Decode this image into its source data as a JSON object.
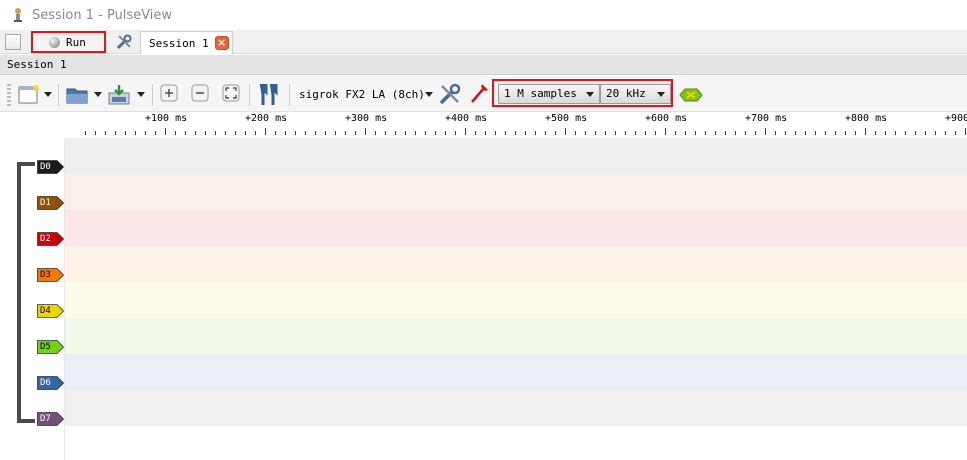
{
  "window": {
    "title": "Session 1 - PulseView"
  },
  "main_toolbar": {
    "run_label": "Run",
    "tabs": [
      {
        "label": "Session 1",
        "close_glyph": "×"
      }
    ]
  },
  "session": {
    "header_label": "Session 1",
    "device_label": "sigrok FX2 LA (8ch)",
    "sample_count": "1 M samples",
    "sample_rate": "20 kHz"
  },
  "ruler": {
    "labels": [
      "+100 ms",
      "+200 ms",
      "+300 ms",
      "+400 ms",
      "+500 ms",
      "+600 ms",
      "+700 ms",
      "+800 ms",
      "+900"
    ]
  },
  "channels": [
    {
      "name": "D0",
      "color": "#1c1c1c",
      "text_color": "#ffffff",
      "lane_bg": "#eeeeee"
    },
    {
      "name": "D1",
      "color": "#8f5202",
      "text_color": "#ffffff",
      "lane_bg": "#f8f1ea"
    },
    {
      "name": "D2",
      "color": "#cc0000",
      "text_color": "#ffffff",
      "lane_bg": "#fbe7e7"
    },
    {
      "name": "D3",
      "color": "#f57900",
      "text_color": "#000000",
      "lane_bg": "#fdf2e8"
    },
    {
      "name": "D4",
      "color": "#edd400",
      "text_color": "#000000",
      "lane_bg": "#fdfbe8"
    },
    {
      "name": "D5",
      "color": "#73d216",
      "text_color": "#000000",
      "lane_bg": "#f1f9ea"
    },
    {
      "name": "D6",
      "color": "#3465a4",
      "text_color": "#ffffff",
      "lane_bg": "#ebeff5"
    },
    {
      "name": "D7",
      "color": "#75507b",
      "text_color": "#ffffff",
      "lane_bg": "#f2eff2"
    }
  ],
  "accent_colors": {
    "highlight_border": "#e0141b"
  }
}
